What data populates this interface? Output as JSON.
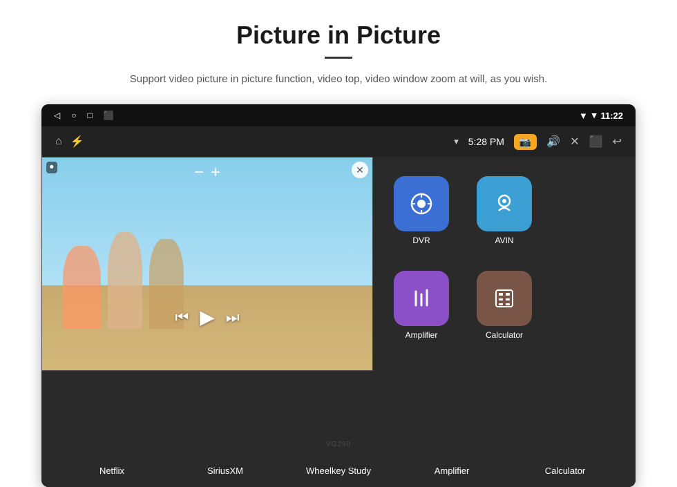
{
  "header": {
    "title": "Picture in Picture",
    "subtitle": "Support video picture in picture function, video top, video window zoom at will, as you wish.",
    "divider": true
  },
  "status_bar": {
    "back_icon": "◁",
    "home_icon": "○",
    "recents_icon": "□",
    "screenshot_icon": "⬛",
    "location_icon": "▼",
    "signal_icon": "▾",
    "time": "11:22"
  },
  "nav_bar": {
    "home_icon": "⌂",
    "usb_icon": "⚡",
    "wifi_icon": "▾",
    "time": "5:28 PM",
    "camera_icon": "📷",
    "volume_icon": "🔊",
    "close_icon": "✕",
    "pip_icon": "⬛",
    "back_icon": "↩"
  },
  "pip_video": {
    "record_icon": "⏺",
    "minus": "−",
    "plus": "+",
    "close": "✕",
    "prev_icon": "⏮",
    "play_icon": "▶",
    "next_icon": "⏭"
  },
  "top_apps": [
    {
      "color": "#4caf50",
      "label": ""
    },
    {
      "color": "#e91e8c",
      "label": ""
    },
    {
      "color": "#9c27b0",
      "label": ""
    }
  ],
  "right_grid_apps": [
    {
      "id": "dvr",
      "color": "#3b6fd4",
      "icon": "📡",
      "label": "DVR"
    },
    {
      "id": "avin",
      "color": "#3b9fd4",
      "icon": "🔌",
      "label": "AVIN"
    },
    {
      "id": "empty1",
      "color": "transparent",
      "icon": "",
      "label": ""
    },
    {
      "id": "amplifier",
      "color": "#8b4fc8",
      "icon": "🎛",
      "label": "Amplifier"
    },
    {
      "id": "calculator",
      "color": "#795548",
      "icon": "🧮",
      "label": "Calculator"
    },
    {
      "id": "empty2",
      "color": "transparent",
      "icon": "",
      "label": ""
    }
  ],
  "bottom_apps": [
    {
      "label": "Netflix"
    },
    {
      "label": "SiriusXM"
    },
    {
      "label": "Wheelkey Study"
    },
    {
      "label": "Amplifier"
    },
    {
      "label": "Calculator"
    }
  ],
  "watermark": "VG290"
}
